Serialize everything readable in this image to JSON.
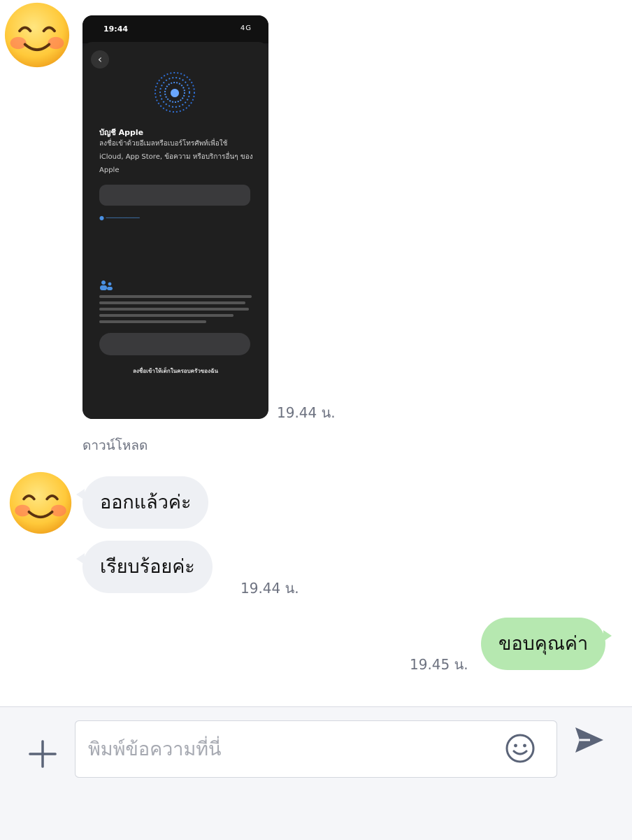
{
  "messages": {
    "screenshot": {
      "status_time": "19:44",
      "status_signal": "4G",
      "sheet_title": "บัญชี Apple",
      "sheet_description": "ลงชื่อเข้าด้วยอีเมลหรือเบอร์โทรศัพท์เพื่อใช้ iCloud, App Store, ข้อความ หรือบริการอื่นๆ ของ Apple",
      "sign_in_with_family": "ลงชื่อเข้าให้เด็กในครอบครัวของฉัน",
      "timestamp": "19.44 น.",
      "download_label": "ดาวน์โหลด"
    },
    "incoming": [
      {
        "text": "ออกแล้วค่ะ"
      },
      {
        "text": "เรียบร้อยค่ะ",
        "timestamp": "19.44 น."
      }
    ],
    "outgoing": [
      {
        "text": "ขอบคุณค่า",
        "timestamp": "19.45 น."
      }
    ]
  },
  "composer": {
    "placeholder": "พิมพ์ข้อความที่นี่",
    "icons": [
      "plus-icon",
      "emoji-icon",
      "send-icon"
    ]
  },
  "colors": {
    "outgoing_bubble": "#b6e8b0",
    "incoming_bubble": "#eef0f4",
    "icon": "#5b6478"
  }
}
